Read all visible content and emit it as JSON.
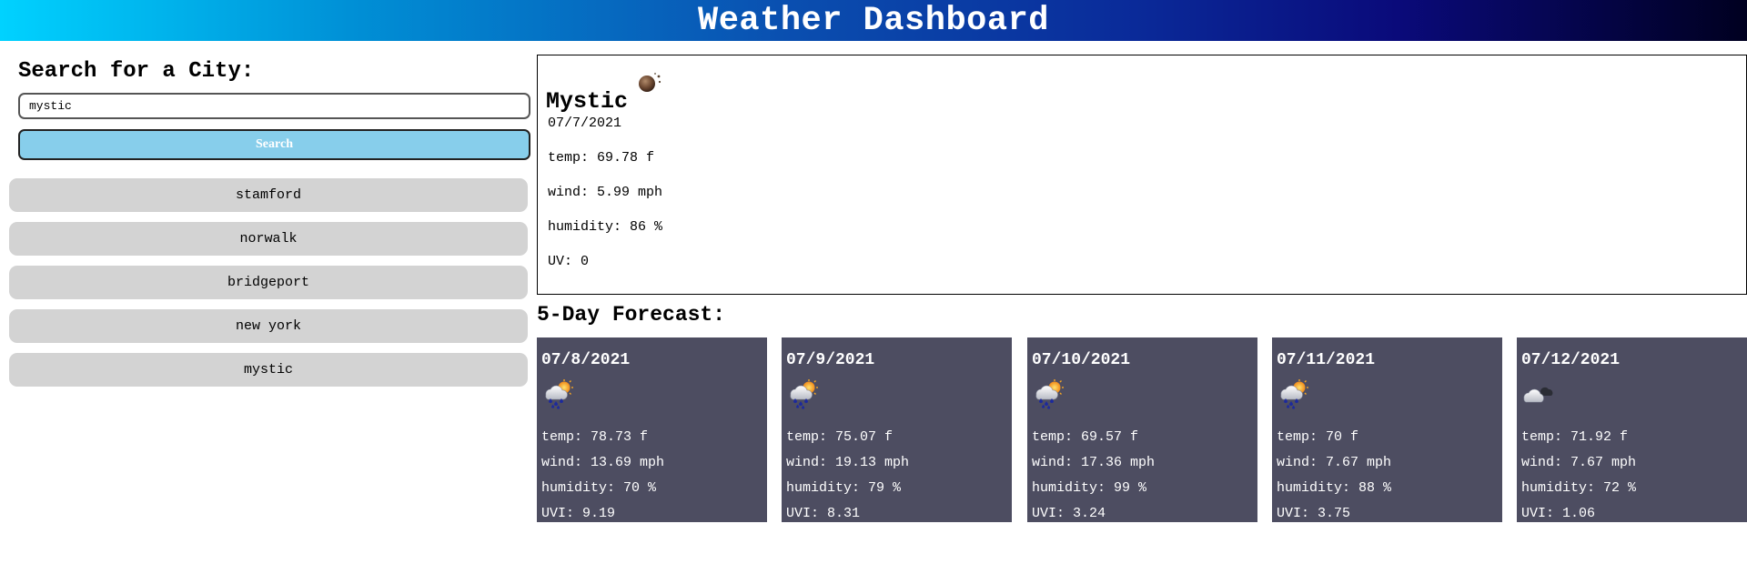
{
  "header": {
    "title": "Weather Dashboard"
  },
  "search": {
    "title": "Search for a City:",
    "input_value": "mystic",
    "button_label": "Search"
  },
  "history": [
    "stamford",
    "norwalk",
    "bridgeport",
    "new york",
    "mystic"
  ],
  "current": {
    "city": "Mystic",
    "icon": "clear-night-moon-icon",
    "date": "07/7/2021",
    "temp": "temp: 69.78 f",
    "wind": "wind: 5.99 mph",
    "humidity": "humidity: 86 %",
    "uv": "UV: 0"
  },
  "forecast": {
    "title": "5-Day Forecast:",
    "days": [
      {
        "date": "07/8/2021",
        "icon": "rain-sun-icon",
        "temp": "temp: 78.73 f",
        "wind": "wind: 13.69 mph",
        "humidity": "humidity: 70 %",
        "uvi": "UVI: 9.19"
      },
      {
        "date": "07/9/2021",
        "icon": "rain-sun-icon",
        "temp": "temp: 75.07 f",
        "wind": "wind: 19.13 mph",
        "humidity": "humidity: 79 %",
        "uvi": "UVI: 8.31"
      },
      {
        "date": "07/10/2021",
        "icon": "rain-sun-icon",
        "temp": "temp: 69.57 f",
        "wind": "wind: 17.36 mph",
        "humidity": "humidity: 99 %",
        "uvi": "UVI: 3.24"
      },
      {
        "date": "07/11/2021",
        "icon": "rain-sun-icon",
        "temp": "temp: 70 f",
        "wind": "wind: 7.67 mph",
        "humidity": "humidity: 88 %",
        "uvi": "UVI: 3.75"
      },
      {
        "date": "07/12/2021",
        "icon": "cloudy-icon",
        "temp": "temp: 71.92 f",
        "wind": "wind: 7.67 mph",
        "humidity": "humidity: 72 %",
        "uvi": "UVI: 1.06"
      }
    ]
  },
  "colors": {
    "header_gradient_start": "#00d2ff",
    "header_gradient_end": "#000020",
    "search_button": "#87ceeb",
    "history_item": "#d3d3d3",
    "forecast_card": "#4d4d61"
  }
}
